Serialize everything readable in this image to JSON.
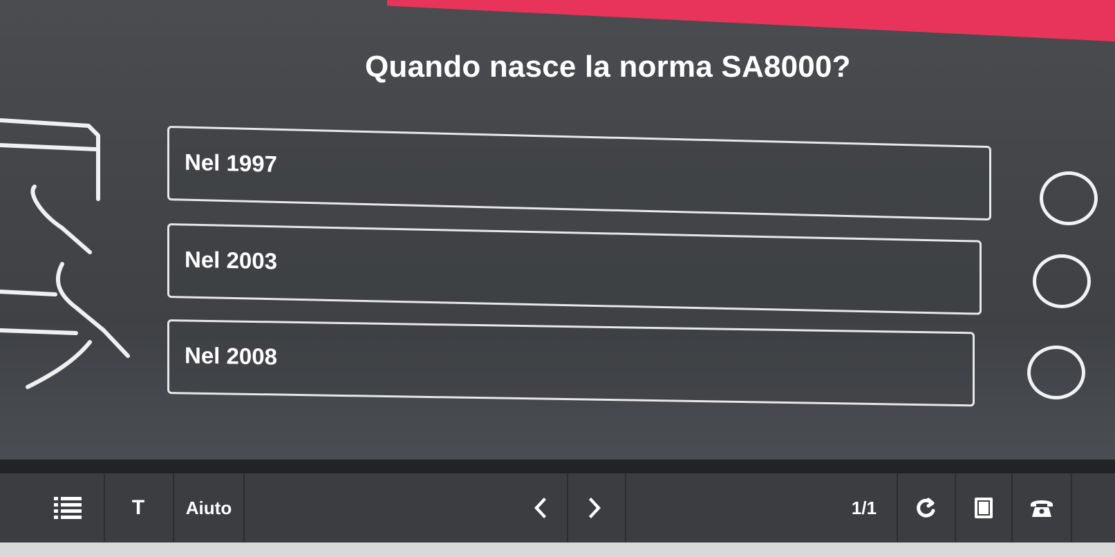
{
  "quiz": {
    "question": "Quando nasce la norma SA8000?",
    "answers": [
      {
        "label": "Nel 1997",
        "selected": false
      },
      {
        "label": "Nel 2003",
        "selected": false
      },
      {
        "label": "Nel 2008",
        "selected": false
      }
    ]
  },
  "toolbar": {
    "menu_icon": "list-icon",
    "text_icon": "T",
    "help_label": "Aiuto",
    "prev_icon": "chevron-left-icon",
    "next_icon": "chevron-right-icon",
    "page_counter": "1/1",
    "reload_icon": "reload-icon",
    "notebook_icon": "notebook-icon",
    "phone_icon": "phone-icon"
  },
  "colors": {
    "accent": "#e8345a",
    "background": "#434549",
    "toolbar": "#3b3d41",
    "text": "#ffffff"
  }
}
